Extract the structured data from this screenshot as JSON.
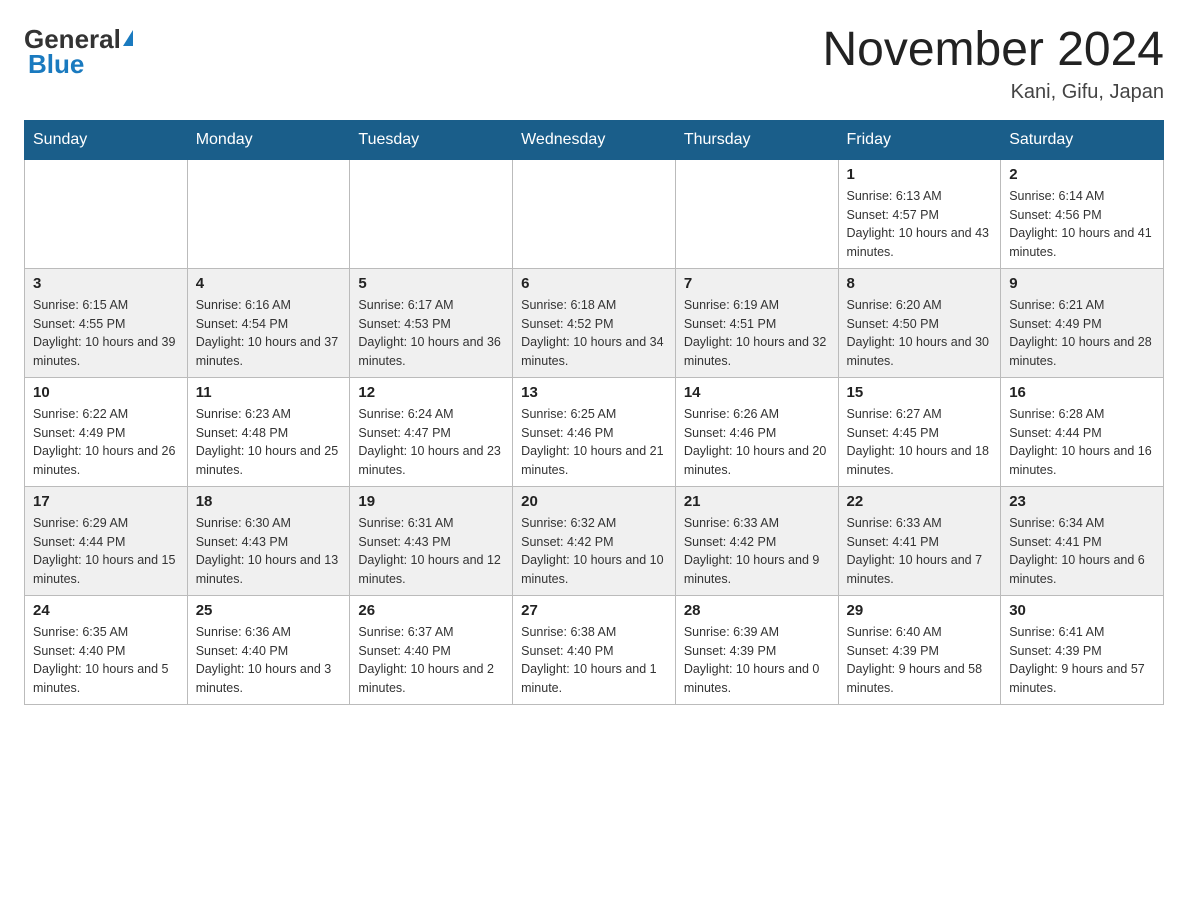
{
  "header": {
    "logo_general": "General",
    "logo_blue": "Blue",
    "month_title": "November 2024",
    "location": "Kani, Gifu, Japan"
  },
  "weekdays": [
    "Sunday",
    "Monday",
    "Tuesday",
    "Wednesday",
    "Thursday",
    "Friday",
    "Saturday"
  ],
  "weeks": [
    [
      {
        "day": "",
        "info": ""
      },
      {
        "day": "",
        "info": ""
      },
      {
        "day": "",
        "info": ""
      },
      {
        "day": "",
        "info": ""
      },
      {
        "day": "",
        "info": ""
      },
      {
        "day": "1",
        "info": "Sunrise: 6:13 AM\nSunset: 4:57 PM\nDaylight: 10 hours and 43 minutes."
      },
      {
        "day": "2",
        "info": "Sunrise: 6:14 AM\nSunset: 4:56 PM\nDaylight: 10 hours and 41 minutes."
      }
    ],
    [
      {
        "day": "3",
        "info": "Sunrise: 6:15 AM\nSunset: 4:55 PM\nDaylight: 10 hours and 39 minutes."
      },
      {
        "day": "4",
        "info": "Sunrise: 6:16 AM\nSunset: 4:54 PM\nDaylight: 10 hours and 37 minutes."
      },
      {
        "day": "5",
        "info": "Sunrise: 6:17 AM\nSunset: 4:53 PM\nDaylight: 10 hours and 36 minutes."
      },
      {
        "day": "6",
        "info": "Sunrise: 6:18 AM\nSunset: 4:52 PM\nDaylight: 10 hours and 34 minutes."
      },
      {
        "day": "7",
        "info": "Sunrise: 6:19 AM\nSunset: 4:51 PM\nDaylight: 10 hours and 32 minutes."
      },
      {
        "day": "8",
        "info": "Sunrise: 6:20 AM\nSunset: 4:50 PM\nDaylight: 10 hours and 30 minutes."
      },
      {
        "day": "9",
        "info": "Sunrise: 6:21 AM\nSunset: 4:49 PM\nDaylight: 10 hours and 28 minutes."
      }
    ],
    [
      {
        "day": "10",
        "info": "Sunrise: 6:22 AM\nSunset: 4:49 PM\nDaylight: 10 hours and 26 minutes."
      },
      {
        "day": "11",
        "info": "Sunrise: 6:23 AM\nSunset: 4:48 PM\nDaylight: 10 hours and 25 minutes."
      },
      {
        "day": "12",
        "info": "Sunrise: 6:24 AM\nSunset: 4:47 PM\nDaylight: 10 hours and 23 minutes."
      },
      {
        "day": "13",
        "info": "Sunrise: 6:25 AM\nSunset: 4:46 PM\nDaylight: 10 hours and 21 minutes."
      },
      {
        "day": "14",
        "info": "Sunrise: 6:26 AM\nSunset: 4:46 PM\nDaylight: 10 hours and 20 minutes."
      },
      {
        "day": "15",
        "info": "Sunrise: 6:27 AM\nSunset: 4:45 PM\nDaylight: 10 hours and 18 minutes."
      },
      {
        "day": "16",
        "info": "Sunrise: 6:28 AM\nSunset: 4:44 PM\nDaylight: 10 hours and 16 minutes."
      }
    ],
    [
      {
        "day": "17",
        "info": "Sunrise: 6:29 AM\nSunset: 4:44 PM\nDaylight: 10 hours and 15 minutes."
      },
      {
        "day": "18",
        "info": "Sunrise: 6:30 AM\nSunset: 4:43 PM\nDaylight: 10 hours and 13 minutes."
      },
      {
        "day": "19",
        "info": "Sunrise: 6:31 AM\nSunset: 4:43 PM\nDaylight: 10 hours and 12 minutes."
      },
      {
        "day": "20",
        "info": "Sunrise: 6:32 AM\nSunset: 4:42 PM\nDaylight: 10 hours and 10 minutes."
      },
      {
        "day": "21",
        "info": "Sunrise: 6:33 AM\nSunset: 4:42 PM\nDaylight: 10 hours and 9 minutes."
      },
      {
        "day": "22",
        "info": "Sunrise: 6:33 AM\nSunset: 4:41 PM\nDaylight: 10 hours and 7 minutes."
      },
      {
        "day": "23",
        "info": "Sunrise: 6:34 AM\nSunset: 4:41 PM\nDaylight: 10 hours and 6 minutes."
      }
    ],
    [
      {
        "day": "24",
        "info": "Sunrise: 6:35 AM\nSunset: 4:40 PM\nDaylight: 10 hours and 5 minutes."
      },
      {
        "day": "25",
        "info": "Sunrise: 6:36 AM\nSunset: 4:40 PM\nDaylight: 10 hours and 3 minutes."
      },
      {
        "day": "26",
        "info": "Sunrise: 6:37 AM\nSunset: 4:40 PM\nDaylight: 10 hours and 2 minutes."
      },
      {
        "day": "27",
        "info": "Sunrise: 6:38 AM\nSunset: 4:40 PM\nDaylight: 10 hours and 1 minute."
      },
      {
        "day": "28",
        "info": "Sunrise: 6:39 AM\nSunset: 4:39 PM\nDaylight: 10 hours and 0 minutes."
      },
      {
        "day": "29",
        "info": "Sunrise: 6:40 AM\nSunset: 4:39 PM\nDaylight: 9 hours and 58 minutes."
      },
      {
        "day": "30",
        "info": "Sunrise: 6:41 AM\nSunset: 4:39 PM\nDaylight: 9 hours and 57 minutes."
      }
    ]
  ]
}
